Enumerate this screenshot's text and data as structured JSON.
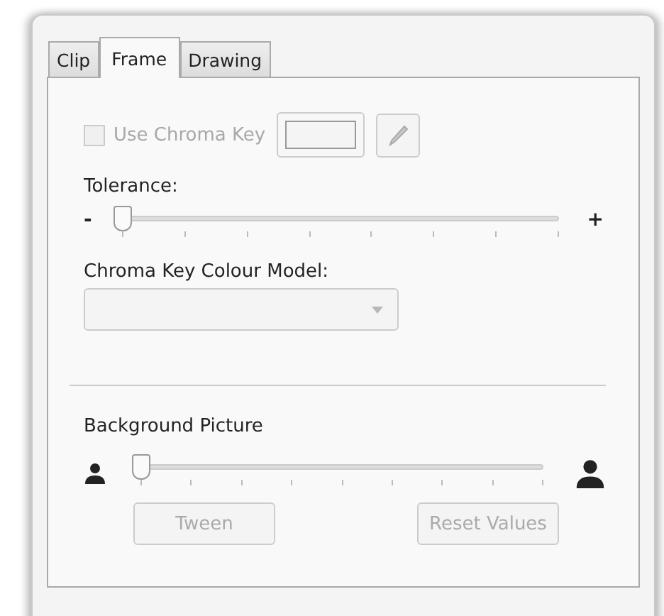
{
  "tabs": [
    {
      "label": "Clip",
      "selected": false
    },
    {
      "label": "Frame",
      "selected": true
    },
    {
      "label": "Drawing",
      "selected": false
    }
  ],
  "chroma_key": {
    "label": "Use Chroma Key",
    "checked": false,
    "disabled": true
  },
  "tolerance": {
    "label": "Tolerance:",
    "min_label": "-",
    "max_label": "+",
    "level": 0
  },
  "colour_model": {
    "label": "Chroma Key Colour Model:",
    "disabled": true
  },
  "background_picture": {
    "label": "Background Picture",
    "level": 0
  },
  "buttons": [
    {
      "label": "Tween",
      "disabled": true
    },
    {
      "label": "Reset Values",
      "disabled": true
    }
  ]
}
